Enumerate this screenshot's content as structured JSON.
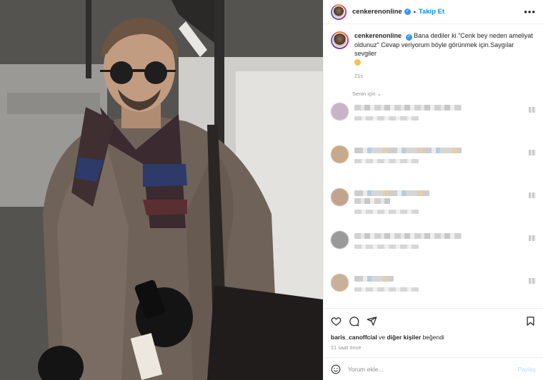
{
  "header": {
    "username": "cenkerenonline",
    "follow_label": "Takip Et",
    "dot": "•",
    "more_label": "•••"
  },
  "caption": {
    "username": "cenkerenonline",
    "text": "Bana dediler ki \"Cenk bey neden ameliyat oldunuz\" Cevap veriyorum böyle görünmek için.Saygılar sevgiler",
    "time": "21s"
  },
  "sort_label": "Senin için ⌄",
  "comments": [
    {
      "avatar_color": "#c9b4c6",
      "colored": false
    },
    {
      "avatar_color": "#c7a98b",
      "colored": true
    },
    {
      "avatar_color": "#c2a48e",
      "colored": true
    },
    {
      "avatar_color": "#9a9a9a",
      "colored": false
    },
    {
      "avatar_color": "#c8b09a",
      "colored": true
    },
    {
      "avatar_color": "#bfa58c",
      "colored": false
    }
  ],
  "likes": {
    "user": "baris_canoffcial",
    "connector": "ve",
    "others": "diğer kişiler",
    "suffix": "beğendi"
  },
  "post_time": "21 saat önce",
  "add_comment": {
    "placeholder": "Yorum ekle...",
    "post_label": "Paylaş"
  },
  "icons": {
    "like": "heart-icon",
    "comment": "comment-icon",
    "share": "share-icon",
    "save": "bookmark-icon",
    "emoji": "emoji-icon"
  },
  "colors": {
    "accent": "#0095f6",
    "verified": "#3897f0",
    "muted": "#8e8e8e"
  }
}
